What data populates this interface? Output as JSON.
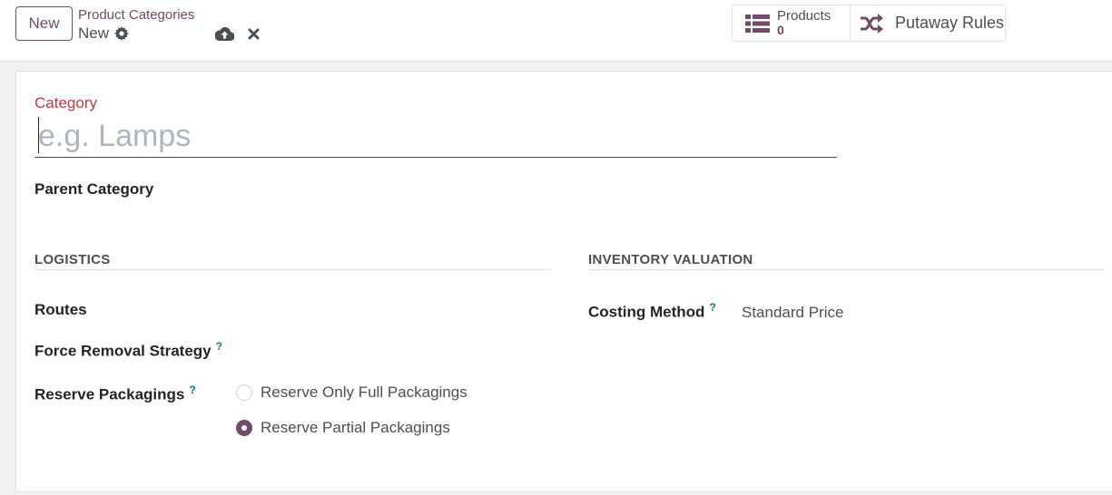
{
  "control_panel": {
    "new_button": "New",
    "breadcrumb": "Product Categories",
    "record_name": "New"
  },
  "smart_buttons": {
    "products": {
      "label": "Products",
      "value": "0"
    },
    "putaway": {
      "label": "Putaway Rules"
    }
  },
  "form": {
    "category_label": "Category",
    "name_placeholder": "e.g. Lamps",
    "name_value": "",
    "parent_category_label": "Parent Category",
    "logistics": {
      "title": "LOGISTICS",
      "routes_label": "Routes",
      "removal_strategy_label": "Force Removal Strategy",
      "reserve_packagings_label": "Reserve Packagings",
      "reserve_options": [
        {
          "label": "Reserve Only Full Packagings",
          "checked": false
        },
        {
          "label": "Reserve Partial Packagings",
          "checked": true
        }
      ]
    },
    "inventory_valuation": {
      "title": "INVENTORY VALUATION",
      "costing_method_label": "Costing Method",
      "costing_method_value": "Standard Price"
    },
    "tooltip_marker": "?"
  },
  "colors": {
    "brand": "#714b67",
    "required_label": "#c4383e",
    "tooltip": "#017e84"
  }
}
